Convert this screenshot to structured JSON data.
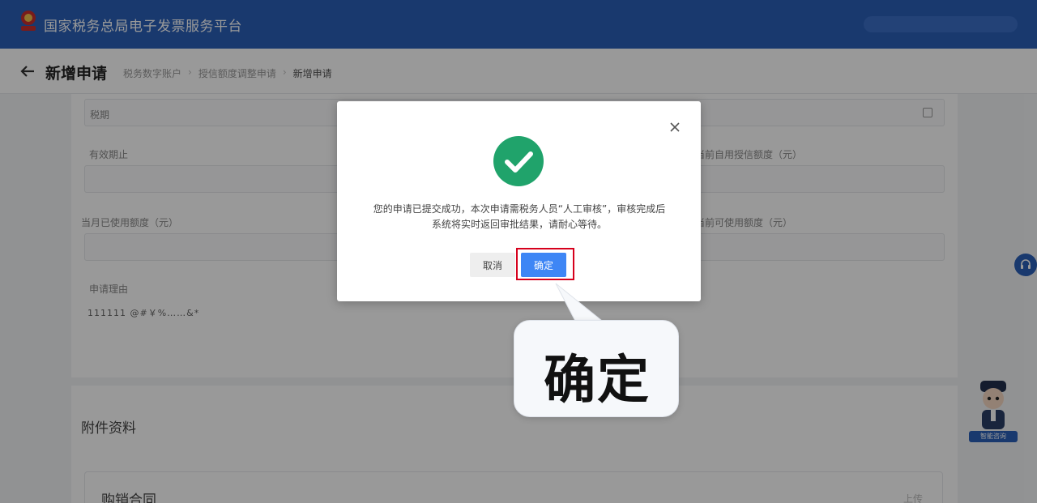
{
  "header": {
    "app_title": "国家税务总局电子发票服务平台"
  },
  "subheader": {
    "page_title": "新增申请",
    "breadcrumb": [
      "税务数字账户",
      "授信额度调整申请",
      "新增申请"
    ]
  },
  "form": {
    "fields": [
      {
        "label": "税期"
      },
      {
        "label": "有效期止"
      },
      {
        "label": "当前自用授信额度（元）"
      },
      {
        "label": "当月已使用额度（元）"
      },
      {
        "label": "当前可使用额度（元）"
      },
      {
        "label": "申请理由"
      }
    ],
    "reason_value": "111111 @#￥%……&*",
    "attachments_title": "附件资料",
    "contract_title": "购销合同",
    "contract_action": "上传"
  },
  "assistant": {
    "label": "智能咨询"
  },
  "modal": {
    "message": "您的申请已提交成功，本次申请需税务人员“人工审核”，审核完成后系统将实时返回审批结果，请耐心等待。",
    "cancel_label": "取消",
    "confirm_label": "确定"
  },
  "callout": {
    "text": "确定"
  },
  "colors": {
    "primary_blue": "#2a5fb8",
    "confirm_button": "#3e86f5",
    "success_green": "#20a36b",
    "highlight_red": "#d6001c"
  },
  "icons": [
    "emblem-logo",
    "back-arrow-icon",
    "calendar-icon",
    "close-icon",
    "success-check-icon",
    "headset-icon"
  ]
}
